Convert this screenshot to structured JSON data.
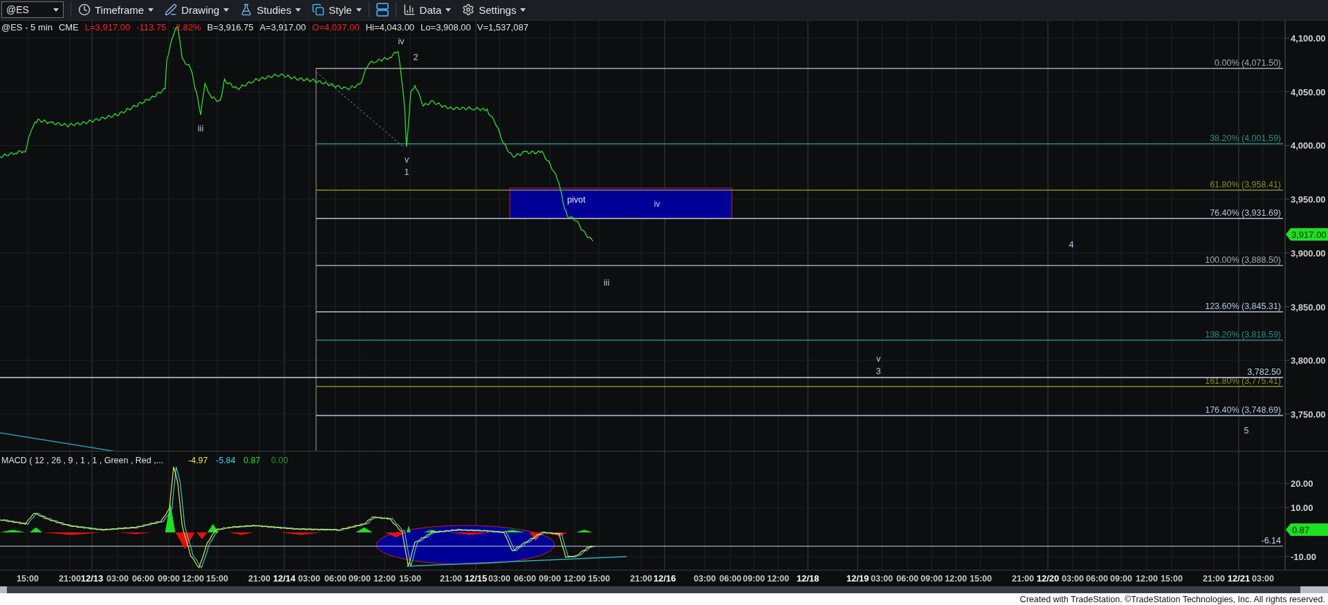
{
  "toolbar": {
    "symbol": "@ES",
    "menus": [
      {
        "label": "Timeframe"
      },
      {
        "label": "Drawing"
      },
      {
        "label": "Studies"
      },
      {
        "label": "Style"
      },
      {
        "label": "Data"
      },
      {
        "label": "Settings"
      }
    ]
  },
  "quote_line": [
    {
      "text": "@ES - 5 min",
      "color": "#e0e0e0"
    },
    {
      "text": "CME",
      "color": "#e0e0e0"
    },
    {
      "text": "L=3,917.00",
      "color": "#ff2020"
    },
    {
      "text": "-113.75",
      "color": "#ff2020"
    },
    {
      "text": "-2.82%",
      "color": "#ff2020"
    },
    {
      "text": "B=3,916.75",
      "color": "#e0e0e0"
    },
    {
      "text": "A=3,917.00",
      "color": "#e0e0e0"
    },
    {
      "text": "O=4,037.00",
      "color": "#ff2020"
    },
    {
      "text": "Hi=4,043.00",
      "color": "#e0e0e0"
    },
    {
      "text": "Lo=3,908.00",
      "color": "#e0e0e0"
    },
    {
      "text": "V=1,537,087",
      "color": "#e0e0e0"
    }
  ],
  "price_axis": {
    "ticks": [
      "4,100.00",
      "4,050.00",
      "4,000.00",
      "3,950.00",
      "3,900.00",
      "3,850.00",
      "3,800.00",
      "3,750.00"
    ],
    "last_price": "3,917.00"
  },
  "fib_levels": [
    {
      "label": "0.00% (4,071.50)",
      "color": "#a8a8a8"
    },
    {
      "label": "38.20% (4,001.59)",
      "color": "#2e8c84"
    },
    {
      "label": "61.80% (3,958.41)",
      "color": "#8c8c24"
    },
    {
      "label": "76.40% (3,931.69)",
      "color": "#b4c4dc"
    },
    {
      "label": "100.00% (3,888.50)",
      "color": "#a8a8a8"
    },
    {
      "label": "123.60% (3,845.31)",
      "color": "#b4c4dc"
    },
    {
      "label": "138.20% (3,818.59)",
      "color": "#2e8c84"
    },
    {
      "label": "161.80% (3,775.41)",
      "color": "#8c8c24"
    },
    {
      "label": "176.40% (3,748.69)",
      "color": "#b4c4dc"
    }
  ],
  "target_line": {
    "label": "3,782.50"
  },
  "pivot_zone": {
    "label": "pivot"
  },
  "wave_labels": [
    "iii",
    "iv",
    "2",
    "v",
    "1",
    "iv",
    "iii",
    "4",
    "v",
    "3",
    "5"
  ],
  "macd": {
    "title": "MACD ( 12 , 26 , 9 , 1 , 1 , Green , Red ,...",
    "values": [
      {
        "text": "-4.97",
        "color": "#e8e840"
      },
      {
        "text": "-5.84",
        "color": "#40d0e0"
      },
      {
        "text": "0.87",
        "color": "#30e030"
      },
      {
        "text": "0.00",
        "color": "#20a020"
      }
    ],
    "ticks": [
      "20.00",
      "10.00",
      "-10.00"
    ],
    "last_value": "0.87",
    "line_label": "-6.14"
  },
  "time_axis": [
    {
      "text": "15:00",
      "kind": "time"
    },
    {
      "text": "21:00",
      "kind": "time"
    },
    {
      "text": "12/13",
      "kind": "date"
    },
    {
      "text": "03:00",
      "kind": "time"
    },
    {
      "text": "06:00",
      "kind": "time"
    },
    {
      "text": "09:00",
      "kind": "time"
    },
    {
      "text": "12:00",
      "kind": "time"
    },
    {
      "text": "15:00",
      "kind": "time"
    },
    {
      "text": "21:00",
      "kind": "time"
    },
    {
      "text": "12/14",
      "kind": "date"
    },
    {
      "text": "03:00",
      "kind": "time"
    },
    {
      "text": "06:00",
      "kind": "time"
    },
    {
      "text": "09:00",
      "kind": "time"
    },
    {
      "text": "12:00",
      "kind": "time"
    },
    {
      "text": "15:00",
      "kind": "time"
    },
    {
      "text": "21:00",
      "kind": "time"
    },
    {
      "text": "12/15",
      "kind": "date"
    },
    {
      "text": "03:00",
      "kind": "time"
    },
    {
      "text": "06:00",
      "kind": "time"
    },
    {
      "text": "09:00",
      "kind": "time"
    },
    {
      "text": "12:00",
      "kind": "time"
    },
    {
      "text": "15:00",
      "kind": "time"
    },
    {
      "text": "21:00",
      "kind": "time"
    },
    {
      "text": "12/16",
      "kind": "date"
    },
    {
      "text": "03:00",
      "kind": "time"
    },
    {
      "text": "06:00",
      "kind": "time"
    },
    {
      "text": "09:00",
      "kind": "time"
    },
    {
      "text": "12:00",
      "kind": "time"
    },
    {
      "text": "12/18",
      "kind": "date"
    },
    {
      "text": "12/19",
      "kind": "date"
    },
    {
      "text": "03:00",
      "kind": "time"
    },
    {
      "text": "06:00",
      "kind": "time"
    },
    {
      "text": "09:00",
      "kind": "time"
    },
    {
      "text": "12:00",
      "kind": "time"
    },
    {
      "text": "15:00",
      "kind": "time"
    },
    {
      "text": "21:00",
      "kind": "time"
    },
    {
      "text": "12/20",
      "kind": "date"
    },
    {
      "text": "03:00",
      "kind": "time"
    },
    {
      "text": "06:00",
      "kind": "time"
    },
    {
      "text": "09:00",
      "kind": "time"
    },
    {
      "text": "12:00",
      "kind": "time"
    },
    {
      "text": "15:00",
      "kind": "time"
    },
    {
      "text": "21:00",
      "kind": "time"
    },
    {
      "text": "12/21",
      "kind": "date"
    },
    {
      "text": "03:00",
      "kind": "time"
    }
  ],
  "footer": "Created with TradeStation. ©TradeStation Technologies, Inc. All rights reserved."
}
